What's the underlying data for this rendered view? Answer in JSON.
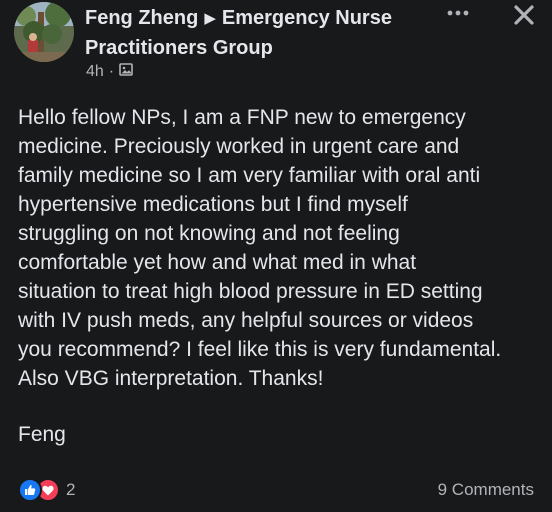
{
  "header": {
    "author": "Feng Zheng",
    "separator_icon": "triangle-right-icon",
    "group": "Emergency Nurse Practitioners Group"
  },
  "meta": {
    "time": "4h",
    "dot": "·",
    "audience_icon": "public-image-icon"
  },
  "actions": {
    "more_icon": "more-dots-icon",
    "close_icon": "close-icon"
  },
  "post": {
    "body": "Hello fellow NPs, I am a FNP new to emergency\nmedicine. Preciously worked in urgent care and\nfamily medicine so I am very familiar with oral anti\nhypertensive medications but I find myself\nstruggling on not knowing and not feeling\ncomfortable yet how and what med in what\nsituation to treat high blood pressure in ED setting\nwith IV push meds, any helpful sources or videos\nyou recommend? I feel like this is very fundamental.\nAlso VBG interpretation. Thanks!",
    "signature": "Feng"
  },
  "footer": {
    "reaction_icons": [
      "like-icon",
      "love-icon"
    ],
    "reaction_count": "2",
    "comments": "9 Comments"
  },
  "colors": {
    "background": "#18191a",
    "text_primary": "#e4e6eb",
    "text_secondary": "#b0b3b8",
    "like_blue": "#1877f2",
    "love_red": "#f33e58"
  }
}
